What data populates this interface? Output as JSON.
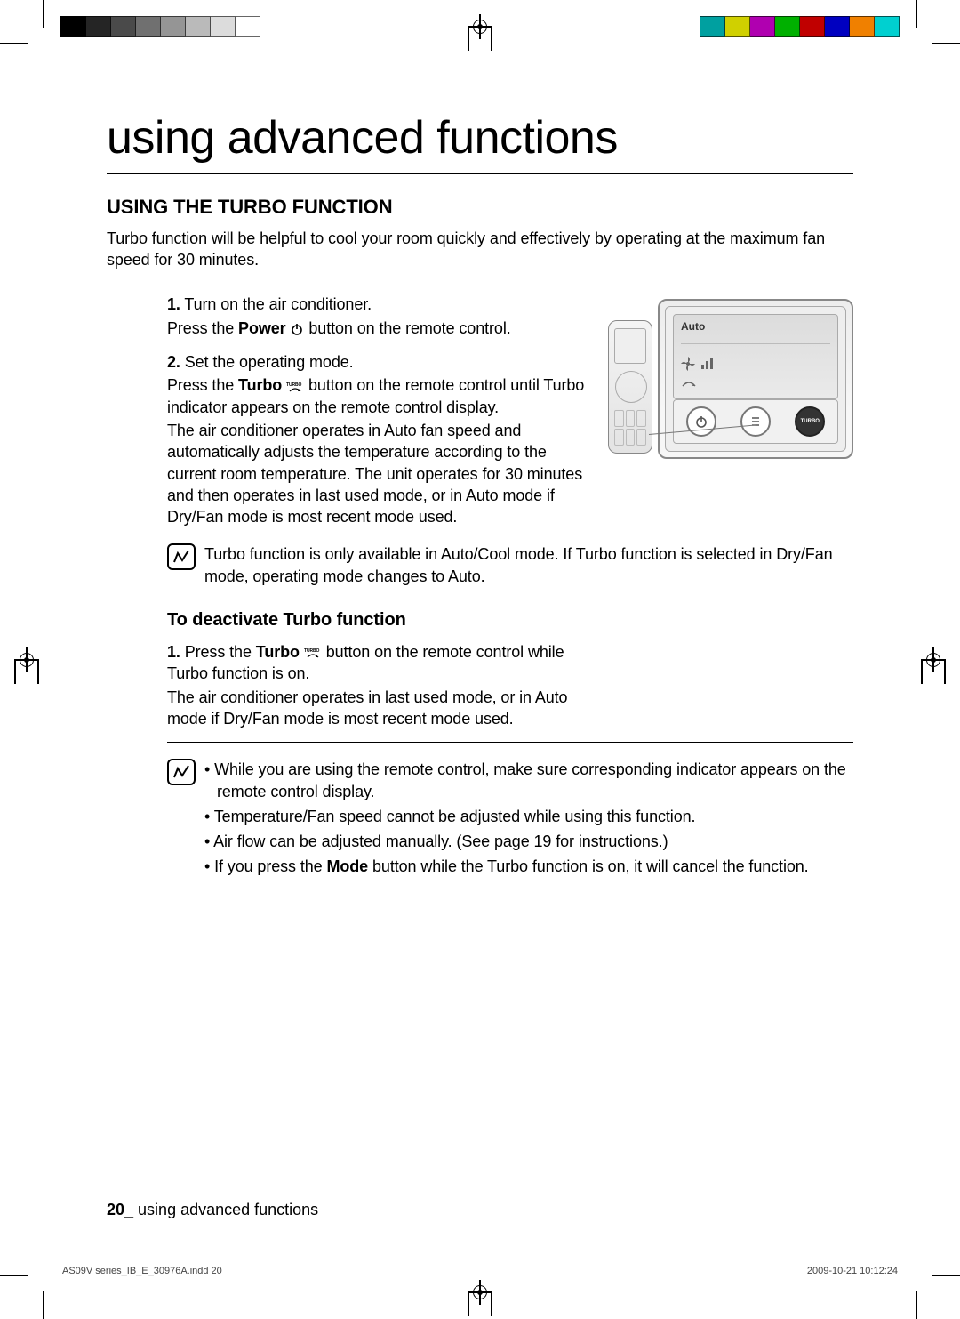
{
  "colorbar_left": [
    "#000000",
    "#252525",
    "#4a4a4a",
    "#707070",
    "#959595",
    "#bababa",
    "#dcdcdc",
    "#ffffff"
  ],
  "colorbar_right": [
    "#00a0a0",
    "#d0d000",
    "#b000b0",
    "#00b000",
    "#c00000",
    "#0000c0",
    "#f08000",
    "#00d0d0"
  ],
  "title": "using advanced functions",
  "section_title": "USING THE TURBO FUNCTION",
  "intro": "Turbo function will be helpful to cool your room quickly and effectively by operating at the maximum fan speed for 30 minutes.",
  "step1_num": "1.",
  "step1": "Turn on the air conditioner.",
  "step1_sub_a": "Press the ",
  "step1_power": "Power",
  "step1_sub_b": " button on the remote control.",
  "step2_num": "2.",
  "step2": "Set the operating mode.",
  "step2_sub_a": "Press the ",
  "step2_turbo": "Turbo",
  "step2_sub_b": " button on the remote control until Turbo indicator appears on the remote control display.",
  "step2_par": "The air conditioner operates in Auto fan speed and automatically adjusts the temperature according to the current room temperature. The unit operates for 30 minutes and then operates in last used mode, or in Auto mode if Dry/Fan mode is most recent mode used.",
  "note1": "Turbo function is only available in Auto/Cool mode. If Turbo function is selected in Dry/Fan mode, operating mode changes to Auto.",
  "deact_title": "To deactivate Turbo function",
  "deact_num": "1.",
  "deact_a": "Press the ",
  "deact_turbo": "Turbo",
  "deact_b": " button on the remote control while Turbo function is on.",
  "deact_par": "The air conditioner operates in last used mode, or in Auto mode if Dry/Fan mode is most recent mode used.",
  "bullets": [
    "While you are using the remote control, make sure corresponding indicator appears on the remote control display.",
    "Temperature/Fan speed cannot be adjusted while using this function.",
    "Air flow can be adjusted manually. (See page 19 for instructions.)"
  ],
  "bullet4_a": "If you press the ",
  "bullet4_mode": "Mode",
  "bullet4_b": " button while the Turbo function is on, it will cancel the function.",
  "panel_auto": "Auto",
  "turbo_btn_label": "TURBO",
  "footer_page": "20",
  "footer_text": "_ using advanced functions",
  "printfoot_file": "AS09V series_IB_E_30976A.indd   20",
  "printfoot_ts": "2009-10-21   10:12:24"
}
